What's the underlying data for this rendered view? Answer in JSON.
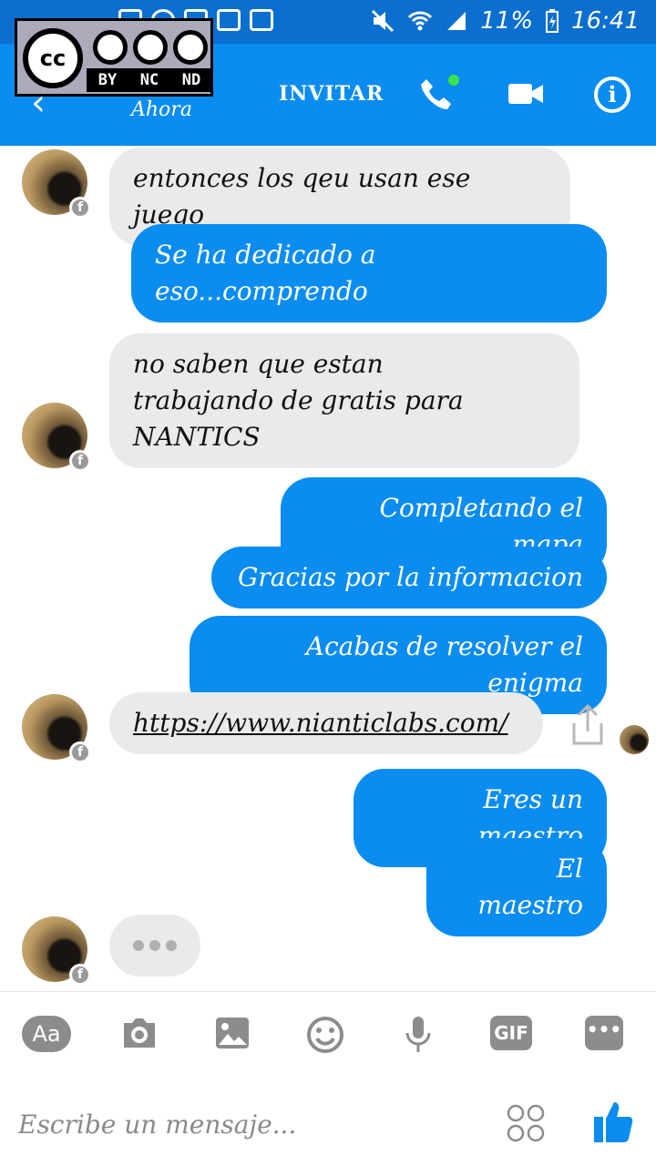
{
  "status_bar": {
    "battery": "11%",
    "time": "16:41"
  },
  "cc_license": {
    "badge_text": "cc",
    "terms": [
      "BY",
      "NC",
      "ND"
    ]
  },
  "header": {
    "subtitle": "Ahora",
    "invite_label": "INVITAR",
    "info_glyph": "i",
    "accent_color": "#0a8cf0",
    "online_color": "#3fe04a"
  },
  "messages": [
    {
      "direction": "in",
      "text": "entonces los qeu usan ese  juego"
    },
    {
      "direction": "out",
      "lines": [
        "Se ha dedicado a",
        "eso...comprendo"
      ]
    },
    {
      "direction": "in",
      "lines": [
        "no saben que  estan",
        "trabajando de gratis  para",
        "NANTICS"
      ]
    },
    {
      "direction": "out",
      "text": "Completando el mapa"
    },
    {
      "direction": "out",
      "text": "Gracias por la informacion"
    },
    {
      "direction": "out",
      "text": "Acabas de resolver el enigma"
    },
    {
      "direction": "in",
      "text": "https://www.nianticlabs.com/",
      "is_link": true
    },
    {
      "direction": "out",
      "text": "Eres un maestro"
    },
    {
      "direction": "out",
      "text": "El maestro"
    }
  ],
  "typing_indicator": "•••",
  "avatar_badge": "f",
  "toolbar": {
    "text_style_label": "Aa",
    "gif_label": "GIF",
    "more_label": "•••",
    "icons": [
      "text-style-icon",
      "camera-icon",
      "image-icon",
      "emoji-icon",
      "microphone-icon",
      "gif-icon",
      "more-icon"
    ]
  },
  "composer": {
    "placeholder": "Escribe un mensaje..."
  }
}
